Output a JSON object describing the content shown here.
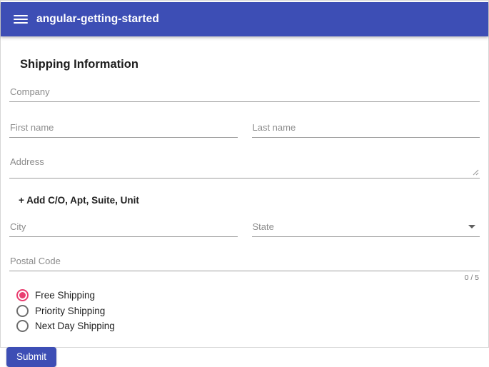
{
  "toolbar": {
    "title": "angular-getting-started"
  },
  "page": {
    "heading": "Shipping Information"
  },
  "form": {
    "fields": {
      "company": {
        "placeholder": "Company",
        "value": ""
      },
      "first_name": {
        "placeholder": "First name",
        "value": ""
      },
      "last_name": {
        "placeholder": "Last name",
        "value": ""
      },
      "address": {
        "placeholder": "Address",
        "value": ""
      },
      "city": {
        "placeholder": "City",
        "value": ""
      },
      "state": {
        "placeholder": "State",
        "value": ""
      },
      "postal_code": {
        "placeholder": "Postal Code",
        "value": "",
        "counter": "0 / 5"
      }
    },
    "add_address_line_label": "+ Add C/O, Apt, Suite, Unit",
    "shipping_options": [
      {
        "label": "Free Shipping",
        "selected": true
      },
      {
        "label": "Priority Shipping",
        "selected": false
      },
      {
        "label": "Next Day Shipping",
        "selected": false
      }
    ],
    "submit_label": "Submit"
  },
  "icons": {
    "menu": "menu-icon (hamburger)",
    "state_dropdown": "arrow-drop-down-icon",
    "address_resize": "resize-handle-icon"
  },
  "colors": {
    "primary": "#3D4EB5",
    "accent": "#E93E70",
    "label_gray": "#8C8C8C",
    "underline_gray": "#9E9E9E"
  }
}
